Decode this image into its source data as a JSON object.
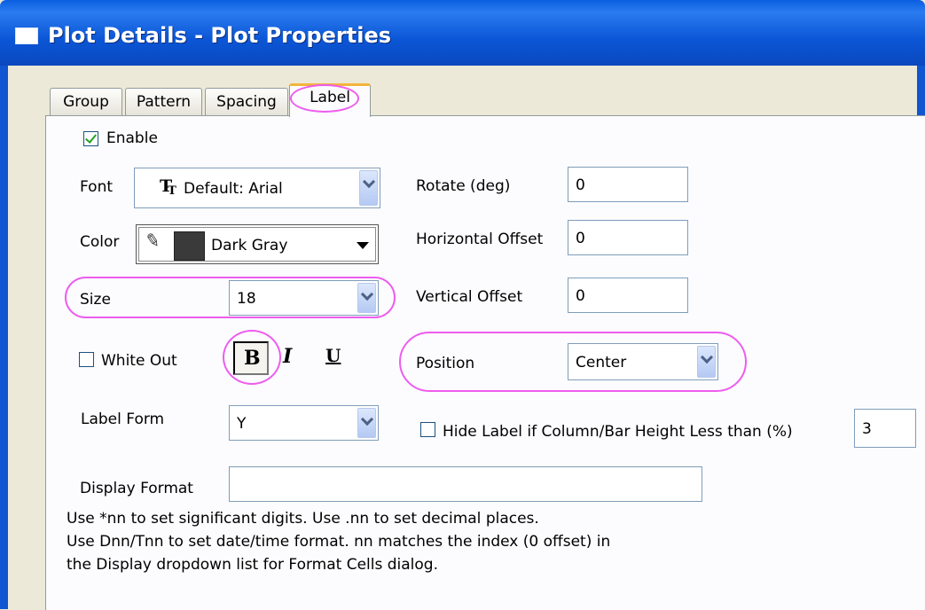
{
  "window": {
    "title": "Plot Details - Plot Properties"
  },
  "tabs": [
    {
      "label": "Group"
    },
    {
      "label": "Pattern"
    },
    {
      "label": "Spacing"
    },
    {
      "label": "Label"
    }
  ],
  "enable": {
    "label": "Enable",
    "checked": true
  },
  "font": {
    "label": "Font",
    "value": "Default: Arial",
    "icon": "font-tt-icon"
  },
  "color": {
    "label": "Color",
    "value": "Dark Gray",
    "swatch": "#3a3a3a"
  },
  "size": {
    "label": "Size",
    "value": "18"
  },
  "white_out": {
    "label": "White Out",
    "checked": false
  },
  "format_buttons": {
    "bold": "B",
    "italic": "I",
    "underline": "U"
  },
  "label_form": {
    "label": "Label Form",
    "value": "Y"
  },
  "display_format": {
    "label": "Display Format",
    "value": ""
  },
  "rotate": {
    "label": "Rotate (deg)",
    "value": "0"
  },
  "h_offset": {
    "label": "Horizontal Offset",
    "value": "0"
  },
  "v_offset": {
    "label": "Vertical Offset",
    "value": "0"
  },
  "position": {
    "label": "Position",
    "value": "Center"
  },
  "hide_label": {
    "label": "Hide Label if Column/Bar Height Less than (%)",
    "checked": false,
    "value": "3"
  },
  "help": {
    "line1": "Use *nn to set significant digits. Use .nn to set decimal places.",
    "line2": "Use Dnn/Tnn to set date/time format. nn matches the index (0 offset) in",
    "line3": "the Display dropdown list for Format Cells dialog."
  },
  "colors": {
    "titlebar": "#0a5fe0",
    "highlight": "#ee5cee",
    "check": "#21a121"
  }
}
